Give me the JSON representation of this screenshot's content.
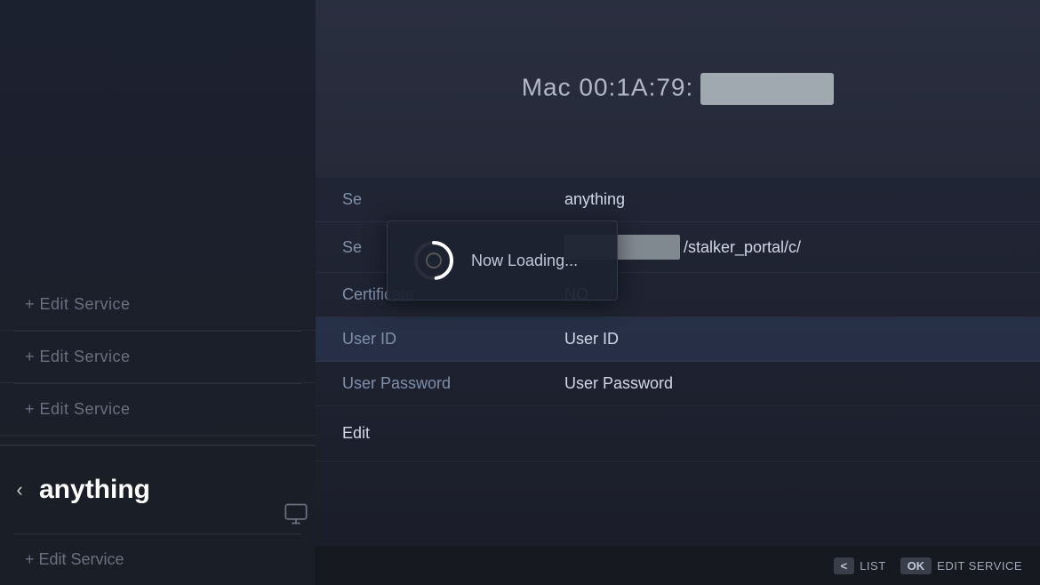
{
  "sidebar": {
    "items": [
      {
        "label": "+ Edit Service"
      },
      {
        "label": "+ Edit Service"
      },
      {
        "label": "+ Edit Service"
      }
    ],
    "active_item": {
      "back_icon": "‹",
      "label": "anything",
      "monitor_icon": "🖥"
    },
    "bottom_item": {
      "label": "+ Edit Service"
    }
  },
  "mac_header": {
    "prefix": "Mac 00:1A:79:",
    "redacted": "redacted"
  },
  "service_detail": {
    "rows": [
      {
        "label": "Se",
        "value": "anything",
        "highlighted": false
      },
      {
        "label": "Se",
        "value": "/stalker_portal/c/",
        "type": "url",
        "highlighted": false
      },
      {
        "label": "Certificate",
        "value": "NO",
        "highlighted": false
      },
      {
        "label": "User ID",
        "value": "User ID",
        "highlighted": true
      },
      {
        "label": "User Password",
        "value": "User Password",
        "highlighted": false
      }
    ],
    "edit_label": "Edit"
  },
  "loading": {
    "text": "Now Loading...",
    "visible": true
  },
  "bottom_bar": {
    "list_key": "<",
    "list_label": "LIST",
    "ok_key": "OK",
    "edit_service_label": "EDIT SERVICE"
  }
}
